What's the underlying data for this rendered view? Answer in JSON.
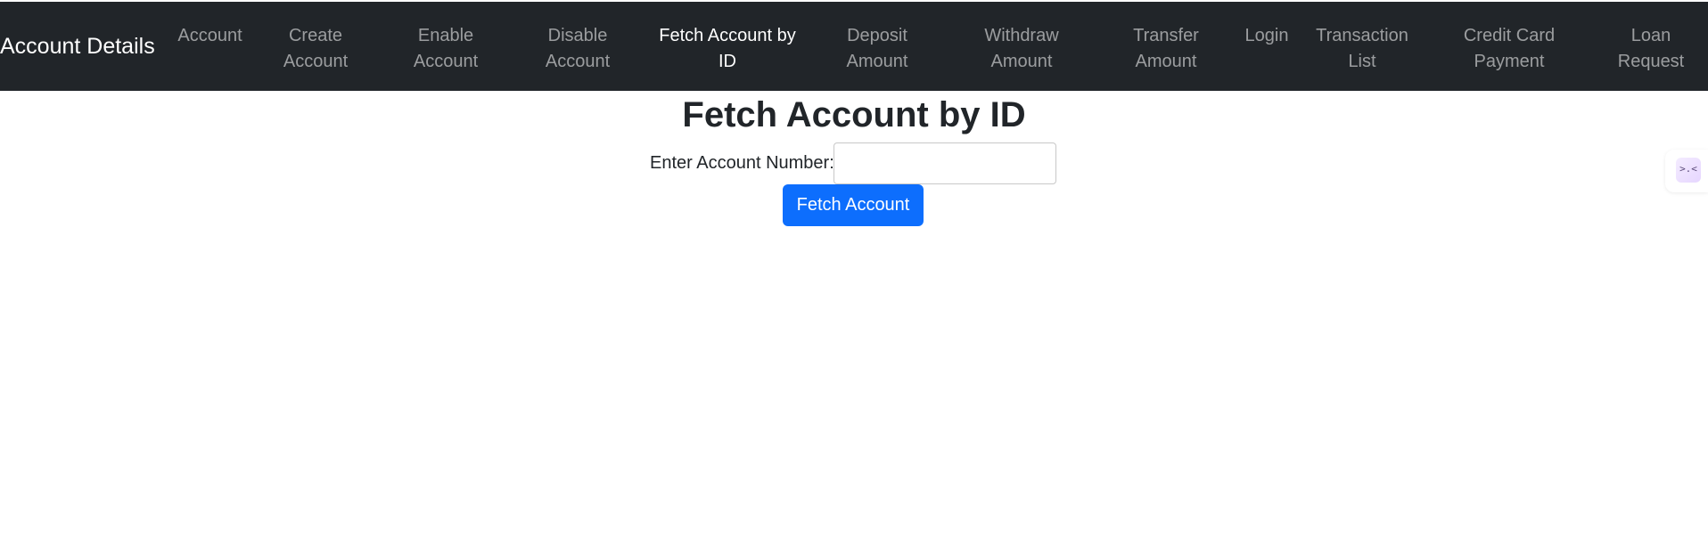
{
  "navbar": {
    "brand": "Account Details",
    "items": [
      {
        "label": "Account"
      },
      {
        "label": "Create Account"
      },
      {
        "label": "Enable Account"
      },
      {
        "label": "Disable Account"
      },
      {
        "label": "Fetch Account by ID",
        "active": true
      },
      {
        "label": "Deposit Amount"
      },
      {
        "label": "Withdraw Amount"
      },
      {
        "label": "Transfer Amount"
      },
      {
        "label": "Login"
      },
      {
        "label": "Transaction List"
      },
      {
        "label": "Credit Card Payment"
      },
      {
        "label": "Loan Request"
      }
    ]
  },
  "main": {
    "title": "Fetch Account by ID",
    "account_label": "Enter Account Number:",
    "account_value": "",
    "fetch_button": "Fetch Account"
  },
  "widget": {
    "icon": "extension-icon",
    "glyph": ">.<"
  },
  "colors": {
    "navbar_bg": "#212529",
    "primary_button": "#0d6efd"
  }
}
